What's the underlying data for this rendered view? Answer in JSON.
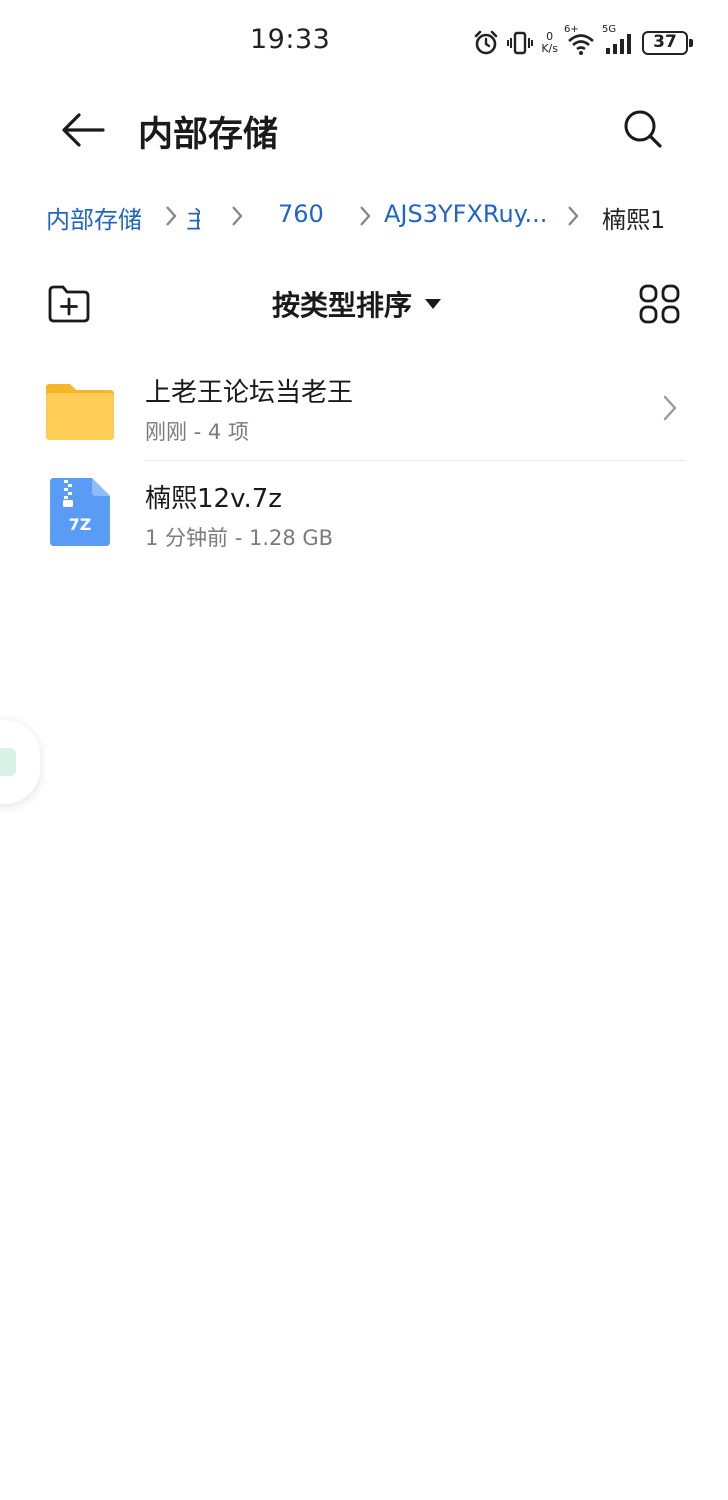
{
  "status_bar": {
    "time": "19:33",
    "net_speed_value": "0",
    "net_speed_unit": "K/s",
    "signal_label_1": "6+",
    "signal_label_2": "5G",
    "battery": "37",
    "icons": [
      "alarm-icon",
      "vibrate-icon",
      "wifi-icon",
      "signal-icon",
      "battery-icon"
    ]
  },
  "header": {
    "title": "内部存储",
    "back_icon": "arrow-left-icon",
    "search_icon": "search-icon"
  },
  "breadcrumbs": [
    {
      "label": "内部存储"
    },
    {
      "label": "主"
    },
    {
      "label": "760"
    },
    {
      "label": "AJS3YFXRuy..."
    },
    {
      "label": "楠熙1"
    }
  ],
  "toolbar": {
    "new_folder_icon": "new-folder-icon",
    "sort_label": "按类型排序",
    "sort_icon": "caret-down-icon",
    "view_icon": "grid-view-icon"
  },
  "files": [
    {
      "name": "上老王论坛当老王",
      "meta": "刚刚 - 4 项",
      "type": "folder",
      "icon": "folder-icon"
    },
    {
      "name": "楠熙12v.7z",
      "meta": "1 分钟前 - 1.28 GB",
      "type": "archive",
      "icon": "archive-7z-icon",
      "badge": "7Z"
    }
  ],
  "colors": {
    "accent": "#2064c8",
    "folder": "#ffcc55",
    "archive": "#5a9cf5",
    "meta_text": "#7b7b7b"
  }
}
